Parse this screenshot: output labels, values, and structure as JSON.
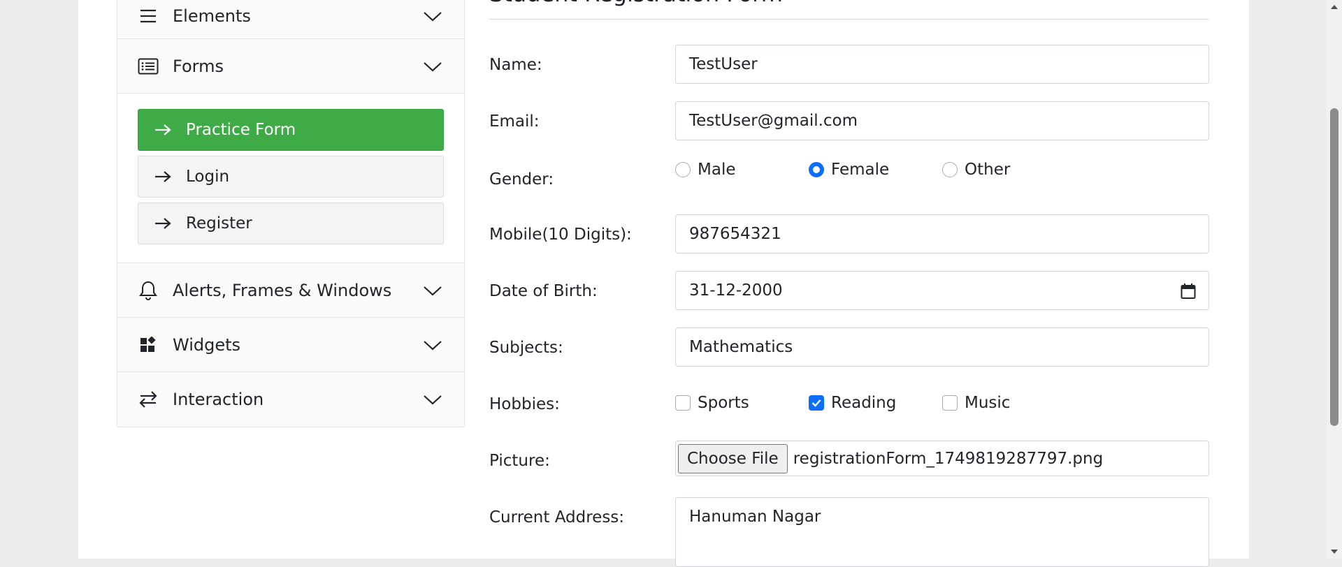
{
  "sidebar": {
    "groups": [
      {
        "label": "Elements",
        "icon": "hamburger-icon"
      },
      {
        "label": "Forms",
        "icon": "list-icon"
      },
      {
        "label": "Alerts, Frames & Windows",
        "icon": "bell-icon"
      },
      {
        "label": "Widgets",
        "icon": "widgets-icon"
      },
      {
        "label": "Interaction",
        "icon": "swap-arrows-icon"
      }
    ],
    "forms_items": [
      {
        "label": "Practice Form",
        "active": true
      },
      {
        "label": "Login",
        "active": false
      },
      {
        "label": "Register",
        "active": false
      }
    ]
  },
  "form": {
    "title": "Student Registration Form",
    "name": {
      "label": "Name:",
      "value": "TestUser"
    },
    "email": {
      "label": "Email:",
      "value": "TestUser@gmail.com"
    },
    "gender": {
      "label": "Gender:",
      "options": [
        "Male",
        "Female",
        "Other"
      ],
      "selected": "Female"
    },
    "mobile": {
      "label": "Mobile(10 Digits):",
      "value": "987654321"
    },
    "dob": {
      "label": "Date of Birth:",
      "value": "31-12-2000"
    },
    "subjects": {
      "label": "Subjects:",
      "value": "Mathematics"
    },
    "hobbies": {
      "label": "Hobbies:",
      "options": [
        "Sports",
        "Reading",
        "Music"
      ],
      "checked": [
        "Reading"
      ]
    },
    "picture": {
      "label": "Picture:",
      "button": "Choose File",
      "filename": "registrationForm_1749819287797.png"
    },
    "address": {
      "label": "Current Address:",
      "value": "Hanuman Nagar"
    }
  },
  "colors": {
    "accent": "#3fab47",
    "primary": "#0d6efd"
  }
}
